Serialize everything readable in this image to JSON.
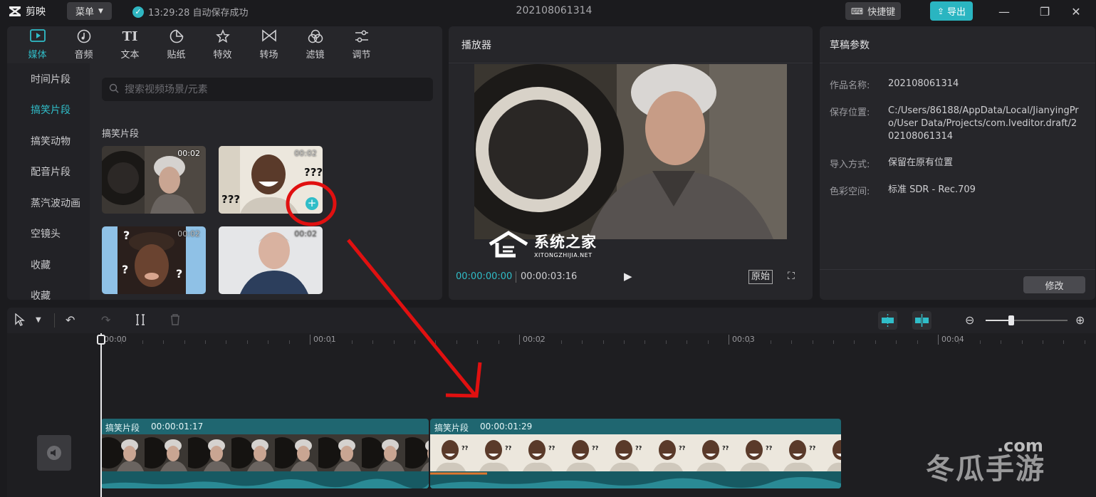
{
  "app": {
    "name": "剪映",
    "menu_label": "菜单",
    "autosave_text": "13:29:28 自动保存成功",
    "document_title": "202108061314",
    "shortcut_label": "快捷键",
    "export_label": "导出"
  },
  "media": {
    "tabs": [
      {
        "label": "媒体",
        "icon": "media-icon"
      },
      {
        "label": "音频",
        "icon": "audio-icon"
      },
      {
        "label": "文本",
        "icon": "text-icon"
      },
      {
        "label": "贴纸",
        "icon": "sticker-icon"
      },
      {
        "label": "特效",
        "icon": "effects-icon"
      },
      {
        "label": "转场",
        "icon": "transition-icon"
      },
      {
        "label": "滤镜",
        "icon": "filter-icon"
      },
      {
        "label": "调节",
        "icon": "adjust-icon"
      }
    ],
    "categories": [
      "时间片段",
      "搞笑片段",
      "搞笑动物",
      "配音片段",
      "蒸汽波动画",
      "空镜头",
      "收藏",
      "收藏"
    ],
    "search_placeholder": "搜索视频场景/元素",
    "section_title": "搞笑片段",
    "thumbnails": [
      {
        "duration": "00:02"
      },
      {
        "duration": "00:02"
      },
      {
        "duration": "00:02"
      },
      {
        "duration": "00:02"
      }
    ]
  },
  "player": {
    "title": "播放器",
    "current_time": "00:00:00:00",
    "total_time": "00:00:03:16",
    "ratio_label": "原始"
  },
  "props": {
    "title": "草稿参数",
    "rows": [
      {
        "key": "作品名称:",
        "value": "202108061314"
      },
      {
        "key": "保存位置:",
        "value": "C:/Users/86188/AppData/Local/JianyingPro/User Data/Projects/com.lveditor.draft/202108061314"
      },
      {
        "key": "导入方式:",
        "value": "保留在原有位置"
      },
      {
        "key": "色彩空间:",
        "value": "标准 SDR - Rec.709"
      }
    ],
    "modify_label": "修改"
  },
  "timeline": {
    "ruler": [
      "00:00",
      "00:01",
      "00:02",
      "00:03",
      "00:04"
    ],
    "clips": [
      {
        "label": "搞笑片段",
        "duration": "00:00:01:17"
      },
      {
        "label": "搞笑片段",
        "duration": "00:00:01:29"
      }
    ]
  },
  "watermarks": {
    "site_cn": "系统之家",
    "site_en": "XITONGZHIJIA.NET",
    "brand": "冬瓜手游",
    "brand_com": ".com"
  },
  "colors": {
    "accent": "#30bdc8",
    "clip_track": "#1f6670",
    "annotation_red": "#e01010"
  }
}
